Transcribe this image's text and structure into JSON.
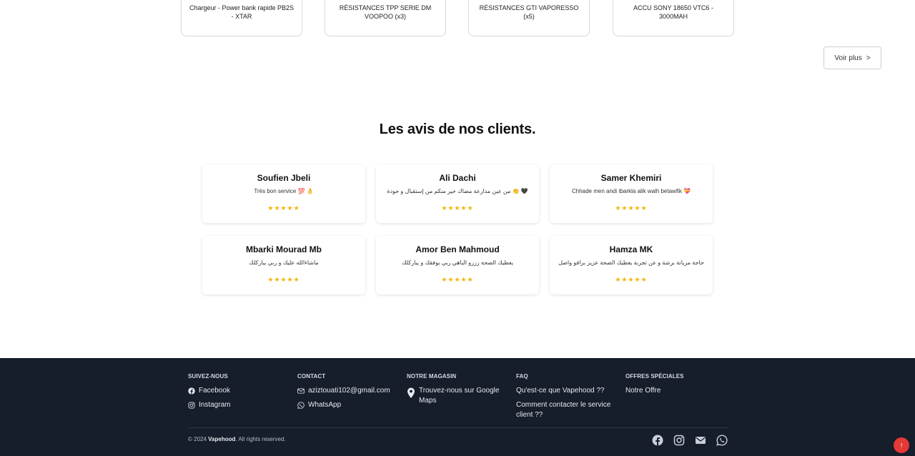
{
  "products": [
    {
      "name": "Chargeur - Power bank rapide PB2S - XTAR"
    },
    {
      "name": "RÉSISTANCES TPP SERIE DM VOOPOO (x3)"
    },
    {
      "name": "RÉSISTANCES GTI VAPORESSO (x5)"
    },
    {
      "name": "ACCU SONY 18650 VTC6 - 3000MAH"
    }
  ],
  "more_button": {
    "label": "Voir plus",
    "chevron": ">"
  },
  "reviews_section": {
    "title": "Les avis de nos clients.",
    "stars": "★★★★★",
    "items": [
      {
        "name": "Soufien Jbeli",
        "text": "Très bon service 💯 👌"
      },
      {
        "name": "Ali Dachi",
        "text": "🖤 👏 من عين مدارعة مضاك خير منكم من إستقبال و جودة"
      },
      {
        "name": "Samer Khemiri",
        "text": "Chhade men andi tbarkla alik walh betawfik 💝"
      },
      {
        "name": "Mbarki Mourad Mb",
        "text": "ماشاءالله عليك و ربي يباركلك"
      },
      {
        "name": "Amor Ben Mahmoud",
        "text": "يعطيك الصحة زززو الباهي ربي يوفقك و يباركلك"
      },
      {
        "name": "Hamza MK",
        "text": "حاجة مزيانة برشة و عن تجربة يعطيك الصحة عزيز برافو واصل"
      }
    ]
  },
  "footer": {
    "columns": [
      {
        "heading": "SUIVEZ-NOUS",
        "links": [
          {
            "label": "Facebook",
            "icon": "facebook-icon"
          },
          {
            "label": "Instagram",
            "icon": "instagram-icon"
          }
        ]
      },
      {
        "heading": "CONTACT",
        "links": [
          {
            "label": "aziztouati102@gmail.com",
            "icon": "mail-icon"
          },
          {
            "label": "WhatsApp",
            "icon": "whatsapp-icon"
          }
        ]
      },
      {
        "heading": "NOTRE MAGASIN",
        "links": [
          {
            "label": "Trouvez-nous sur Google Maps",
            "icon": "map-pin-icon"
          }
        ]
      },
      {
        "heading": "FAQ",
        "links": [
          {
            "label": "Qu'est-ce que Vapehood ??"
          },
          {
            "label": "Comment contacter le service client ??"
          }
        ]
      },
      {
        "heading": "OFFRES SPÉCIALES",
        "links": [
          {
            "label": "Notre Offre"
          }
        ]
      }
    ],
    "copyright_prefix": "© 2024",
    "brand": "Vapehood",
    "copyright_suffix": ". All rights reserved.",
    "social_icons": [
      "facebook-icon",
      "instagram-icon",
      "mail-icon",
      "whatsapp-icon"
    ]
  },
  "scroll_top": {
    "symbol": "↑"
  },
  "colors": {
    "footer_bg": "#161d2b",
    "star": "#f5b301",
    "scroll_top": "#e53935"
  }
}
